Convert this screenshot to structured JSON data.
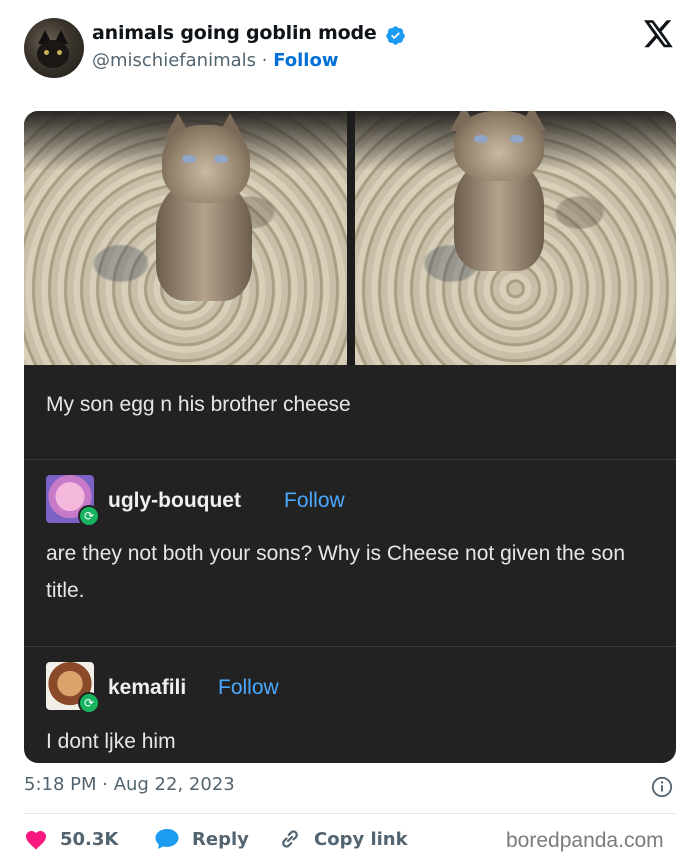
{
  "tweet": {
    "display_name": "animals going goblin mode",
    "handle": "@mischiefanimals",
    "separator": " · ",
    "follow_label": "Follow",
    "timestamp": "5:18 PM · Aug 22, 2023"
  },
  "media": {
    "caption": "My son egg n his brother cheese",
    "reblogs": [
      {
        "username": "ugly-bouquet",
        "follow_label": "Follow",
        "text": "are they not both your sons? Why is Cheese not given the son title."
      },
      {
        "username": "kemafili",
        "follow_label": "Follow",
        "text": "I dont ljke him"
      }
    ]
  },
  "actions": {
    "likes": "50.3K",
    "reply_label": "Reply",
    "copy_link_label": "Copy link"
  },
  "watermark": "boredpanda.com",
  "colors": {
    "accent": "#006fd6",
    "like": "#f91880",
    "reply": "#1d9bf0",
    "reblog_badge": "#17b35f",
    "tumblr_follow": "#4aa8ff"
  },
  "icons": {
    "verified": "verified-badge-icon",
    "x_logo": "x-logo-icon",
    "info": "info-icon",
    "like": "heart-icon",
    "reply": "speech-bubble-icon",
    "copy_link": "link-icon"
  }
}
